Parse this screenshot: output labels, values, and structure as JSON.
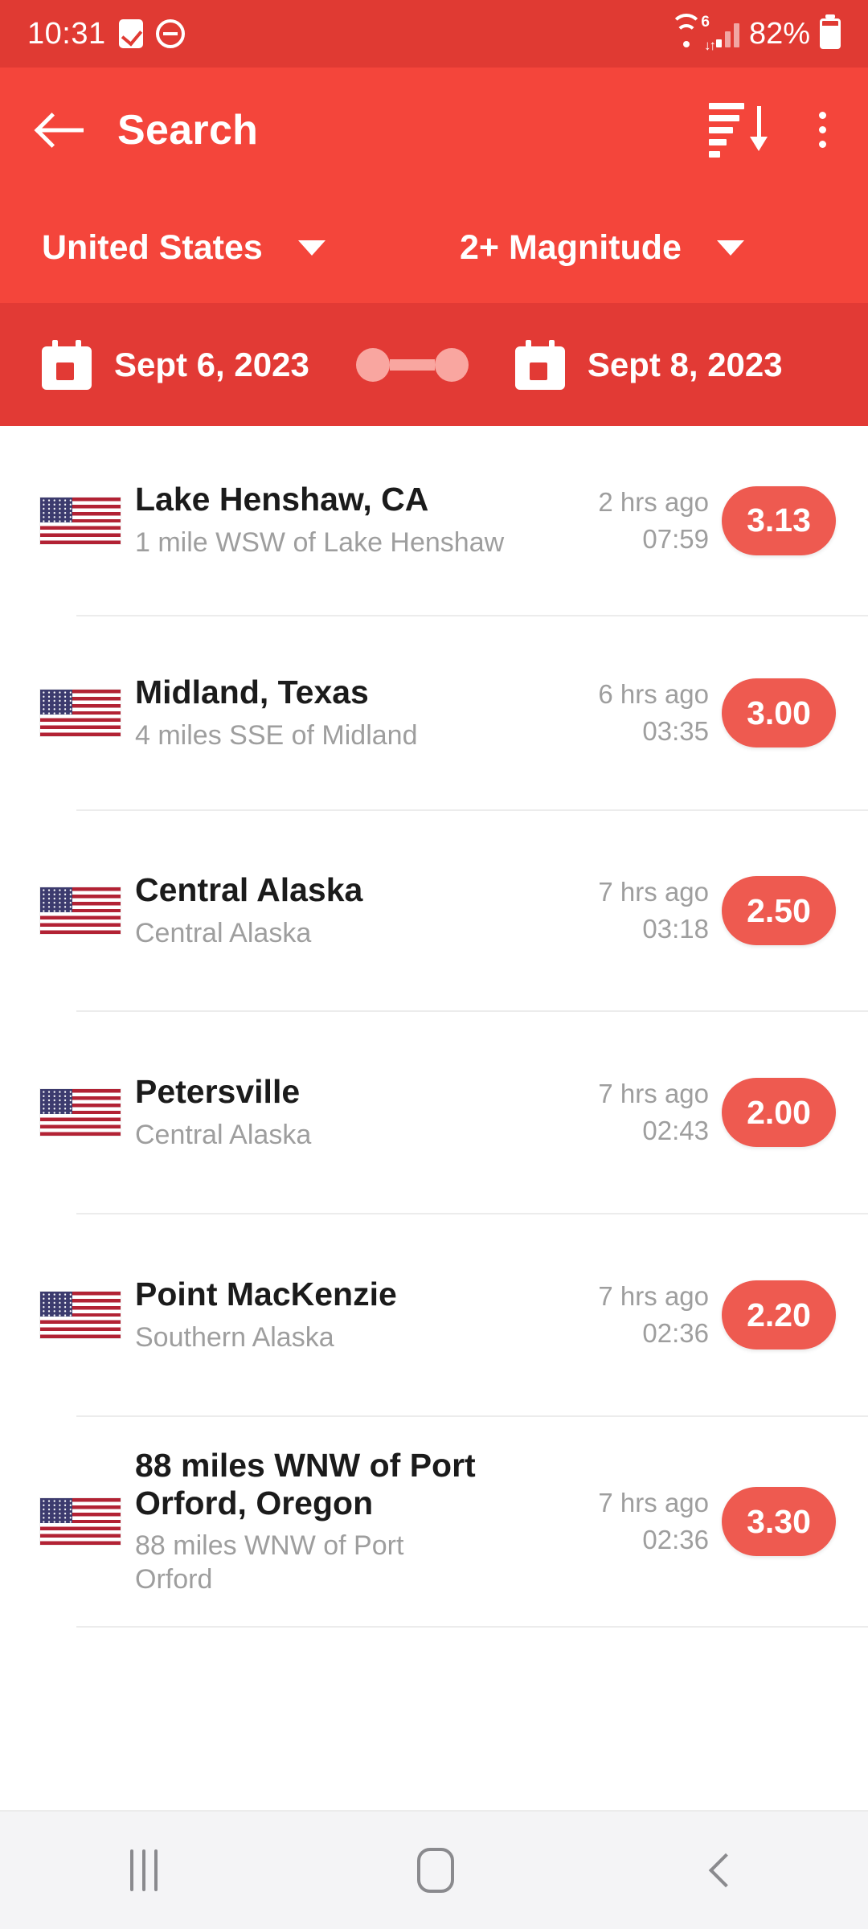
{
  "status_bar": {
    "time": "10:31",
    "icons": [
      "checkbox-icon",
      "do-not-disturb-icon"
    ],
    "wifi": {
      "name": "wifi-6-icon",
      "generation": "6"
    },
    "signal": "cellular-signal-icon",
    "battery_percent": "82%",
    "battery": "battery-icon"
  },
  "app_bar": {
    "back": "back-arrow-icon",
    "title": "Search",
    "sort": "sort-descending-icon",
    "overflow": "more-vertical-icon"
  },
  "filters": {
    "country": {
      "label": "United States",
      "caret": "chevron-down-icon"
    },
    "magnitude": {
      "label": "2+ Magnitude",
      "caret": "chevron-down-icon"
    }
  },
  "date_range": {
    "start": {
      "label": "Sept 6, 2023",
      "icon": "calendar-icon"
    },
    "end": {
      "label": "Sept 8, 2023",
      "icon": "calendar-icon"
    },
    "slider": "date-range-slider"
  },
  "colors": {
    "status_bar": "#E03A33",
    "app_bar": "#F4453B",
    "date_row": "#E23A35",
    "magnitude_badge": "#EE5A50",
    "divider": "#ECECEC",
    "nav_bar": "#F4F4F6"
  },
  "results": [
    {
      "flag": "us-flag-icon",
      "title": "Lake Henshaw, CA",
      "subtitle": "1 mile WSW of Lake Henshaw",
      "ago": "2 hrs ago",
      "time": "07:59",
      "magnitude": "3.13"
    },
    {
      "flag": "us-flag-icon",
      "title": "Midland, Texas",
      "subtitle": "4 miles SSE of Midland",
      "ago": "6 hrs ago",
      "time": "03:35",
      "magnitude": "3.00"
    },
    {
      "flag": "us-flag-icon",
      "title": "Central Alaska",
      "subtitle": "Central Alaska",
      "ago": "7 hrs ago",
      "time": "03:18",
      "magnitude": "2.50"
    },
    {
      "flag": "us-flag-icon",
      "title": "Petersville",
      "subtitle": "Central Alaska",
      "ago": "7 hrs ago",
      "time": "02:43",
      "magnitude": "2.00"
    },
    {
      "flag": "us-flag-icon",
      "title": "Point MacKenzie",
      "subtitle": "Southern Alaska",
      "ago": "7 hrs ago",
      "time": "02:36",
      "magnitude": "2.20"
    },
    {
      "flag": "us-flag-icon",
      "title": "88 miles WNW of Port Orford, Oregon",
      "subtitle": "88 miles WNW of Port Orford",
      "ago": "7 hrs ago",
      "time": "02:36",
      "magnitude": "3.30"
    }
  ],
  "nav_bar": {
    "recents": "recents-icon",
    "home": "home-icon",
    "back": "back-icon"
  }
}
